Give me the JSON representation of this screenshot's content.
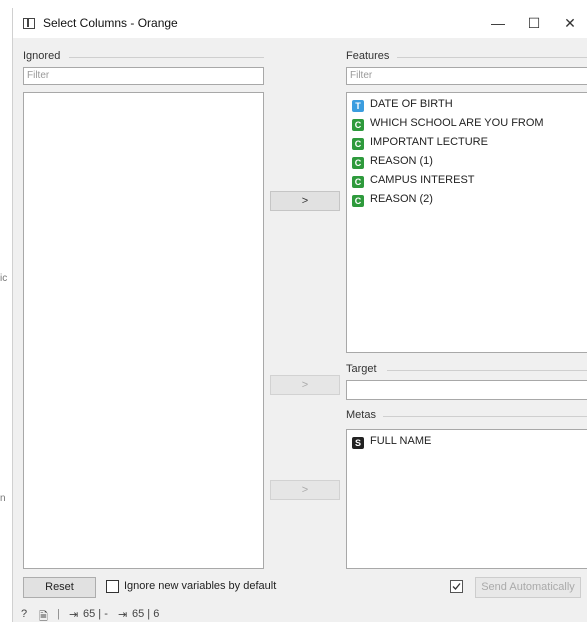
{
  "window": {
    "title": "Select Columns - Orange"
  },
  "controls": {
    "minimize": "—",
    "maximize": "☐",
    "close": "✕"
  },
  "background": {
    "fragments": [
      "ic",
      "n"
    ]
  },
  "ignored": {
    "label": "Ignored",
    "filter_placeholder": "Filter",
    "items": []
  },
  "features": {
    "label": "Features",
    "filter_placeholder": "Filter",
    "items": [
      {
        "type": "T",
        "color": "#3b9ddf",
        "name": "DATE OF BIRTH"
      },
      {
        "type": "C",
        "color": "#2e9a3c",
        "name": "WHICH SCHOOL ARE YOU FROM"
      },
      {
        "type": "C",
        "color": "#2e9a3c",
        "name": "IMPORTANT LECTURE"
      },
      {
        "type": "C",
        "color": "#2e9a3c",
        "name": "REASON (1)"
      },
      {
        "type": "C",
        "color": "#2e9a3c",
        "name": "CAMPUS INTEREST"
      },
      {
        "type": "C",
        "color": "#2e9a3c",
        "name": "REASON (2)"
      }
    ]
  },
  "target": {
    "label": "Target",
    "value": ""
  },
  "metas": {
    "label": "Metas",
    "items": [
      {
        "type": "S",
        "color": "#222222",
        "name": "FULL NAME"
      }
    ]
  },
  "move_buttons": {
    "features": ">",
    "target": ">",
    "metas": ">"
  },
  "bottom": {
    "reset_label": "Reset",
    "ignore_new_label": "Ignore new variables by default",
    "ignore_new_checked": false,
    "send_auto_checked": true,
    "send_auto_label": "Send Automatically"
  },
  "status": {
    "help_icon": "?",
    "doc_icon": "🗎",
    "input_icon": "⇥",
    "input_summary": "65 | -",
    "output_icon": "⇥",
    "output_summary": "65 | 6"
  }
}
